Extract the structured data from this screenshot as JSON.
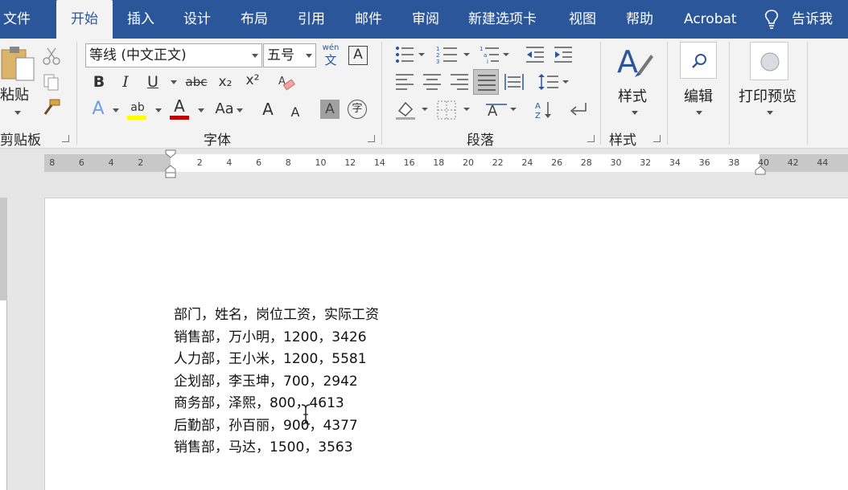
{
  "menu": {
    "tabs": [
      "文件",
      "开始",
      "插入",
      "设计",
      "布局",
      "引用",
      "邮件",
      "审阅",
      "新建选项卡",
      "视图",
      "帮助",
      "Acrobat"
    ],
    "active": "开始",
    "tell_me": "告诉我"
  },
  "ribbon": {
    "clipboard": {
      "paste": "粘贴",
      "label": "剪贴板"
    },
    "font": {
      "font_name": "等线 (中文正文)",
      "font_size": "五号",
      "pinyin_top": "wén",
      "pinyin_bottom": "文",
      "border_char": "A",
      "bold": "B",
      "italic": "I",
      "underline": "U",
      "strike": "abc",
      "subscript": "x₂",
      "superscript": "x²",
      "effects": "A",
      "highlight": "ab",
      "font_color": "A",
      "change_case": "Aa",
      "grow": "A",
      "shrink": "A",
      "char_shade": "A",
      "enclose": "字",
      "label": "字体"
    },
    "paragraph": {
      "label": "段落"
    },
    "styles": {
      "button": "样式",
      "label": "样式"
    },
    "editing": {
      "button": "编辑"
    },
    "print_preview": {
      "button": "打印预览"
    }
  },
  "ruler": {
    "left_numbers": [
      "8",
      "6",
      "4",
      "2"
    ],
    "right_numbers": [
      "2",
      "4",
      "6",
      "8",
      "10",
      "12",
      "14",
      "16",
      "18",
      "20",
      "22",
      "24",
      "26",
      "28",
      "30",
      "32",
      "34",
      "36",
      "38",
      "40",
      "42",
      "44"
    ]
  },
  "document": {
    "lines": [
      "部门，姓名，岗位工资，实际工资",
      "销售部，万小明，1200，3426",
      "人力部，王小米，1200，5581",
      "企划部，李玉坤，700，2942",
      "商务部，泽熙，800，4613",
      "后勤部，孙百丽，900，4377",
      "销售部，马达，1500，3563"
    ]
  },
  "colors": {
    "title_bar": "#2b579a",
    "ribbon": "#f3f3f3",
    "highlight": "#ffff00",
    "font_color": "#c00000"
  }
}
